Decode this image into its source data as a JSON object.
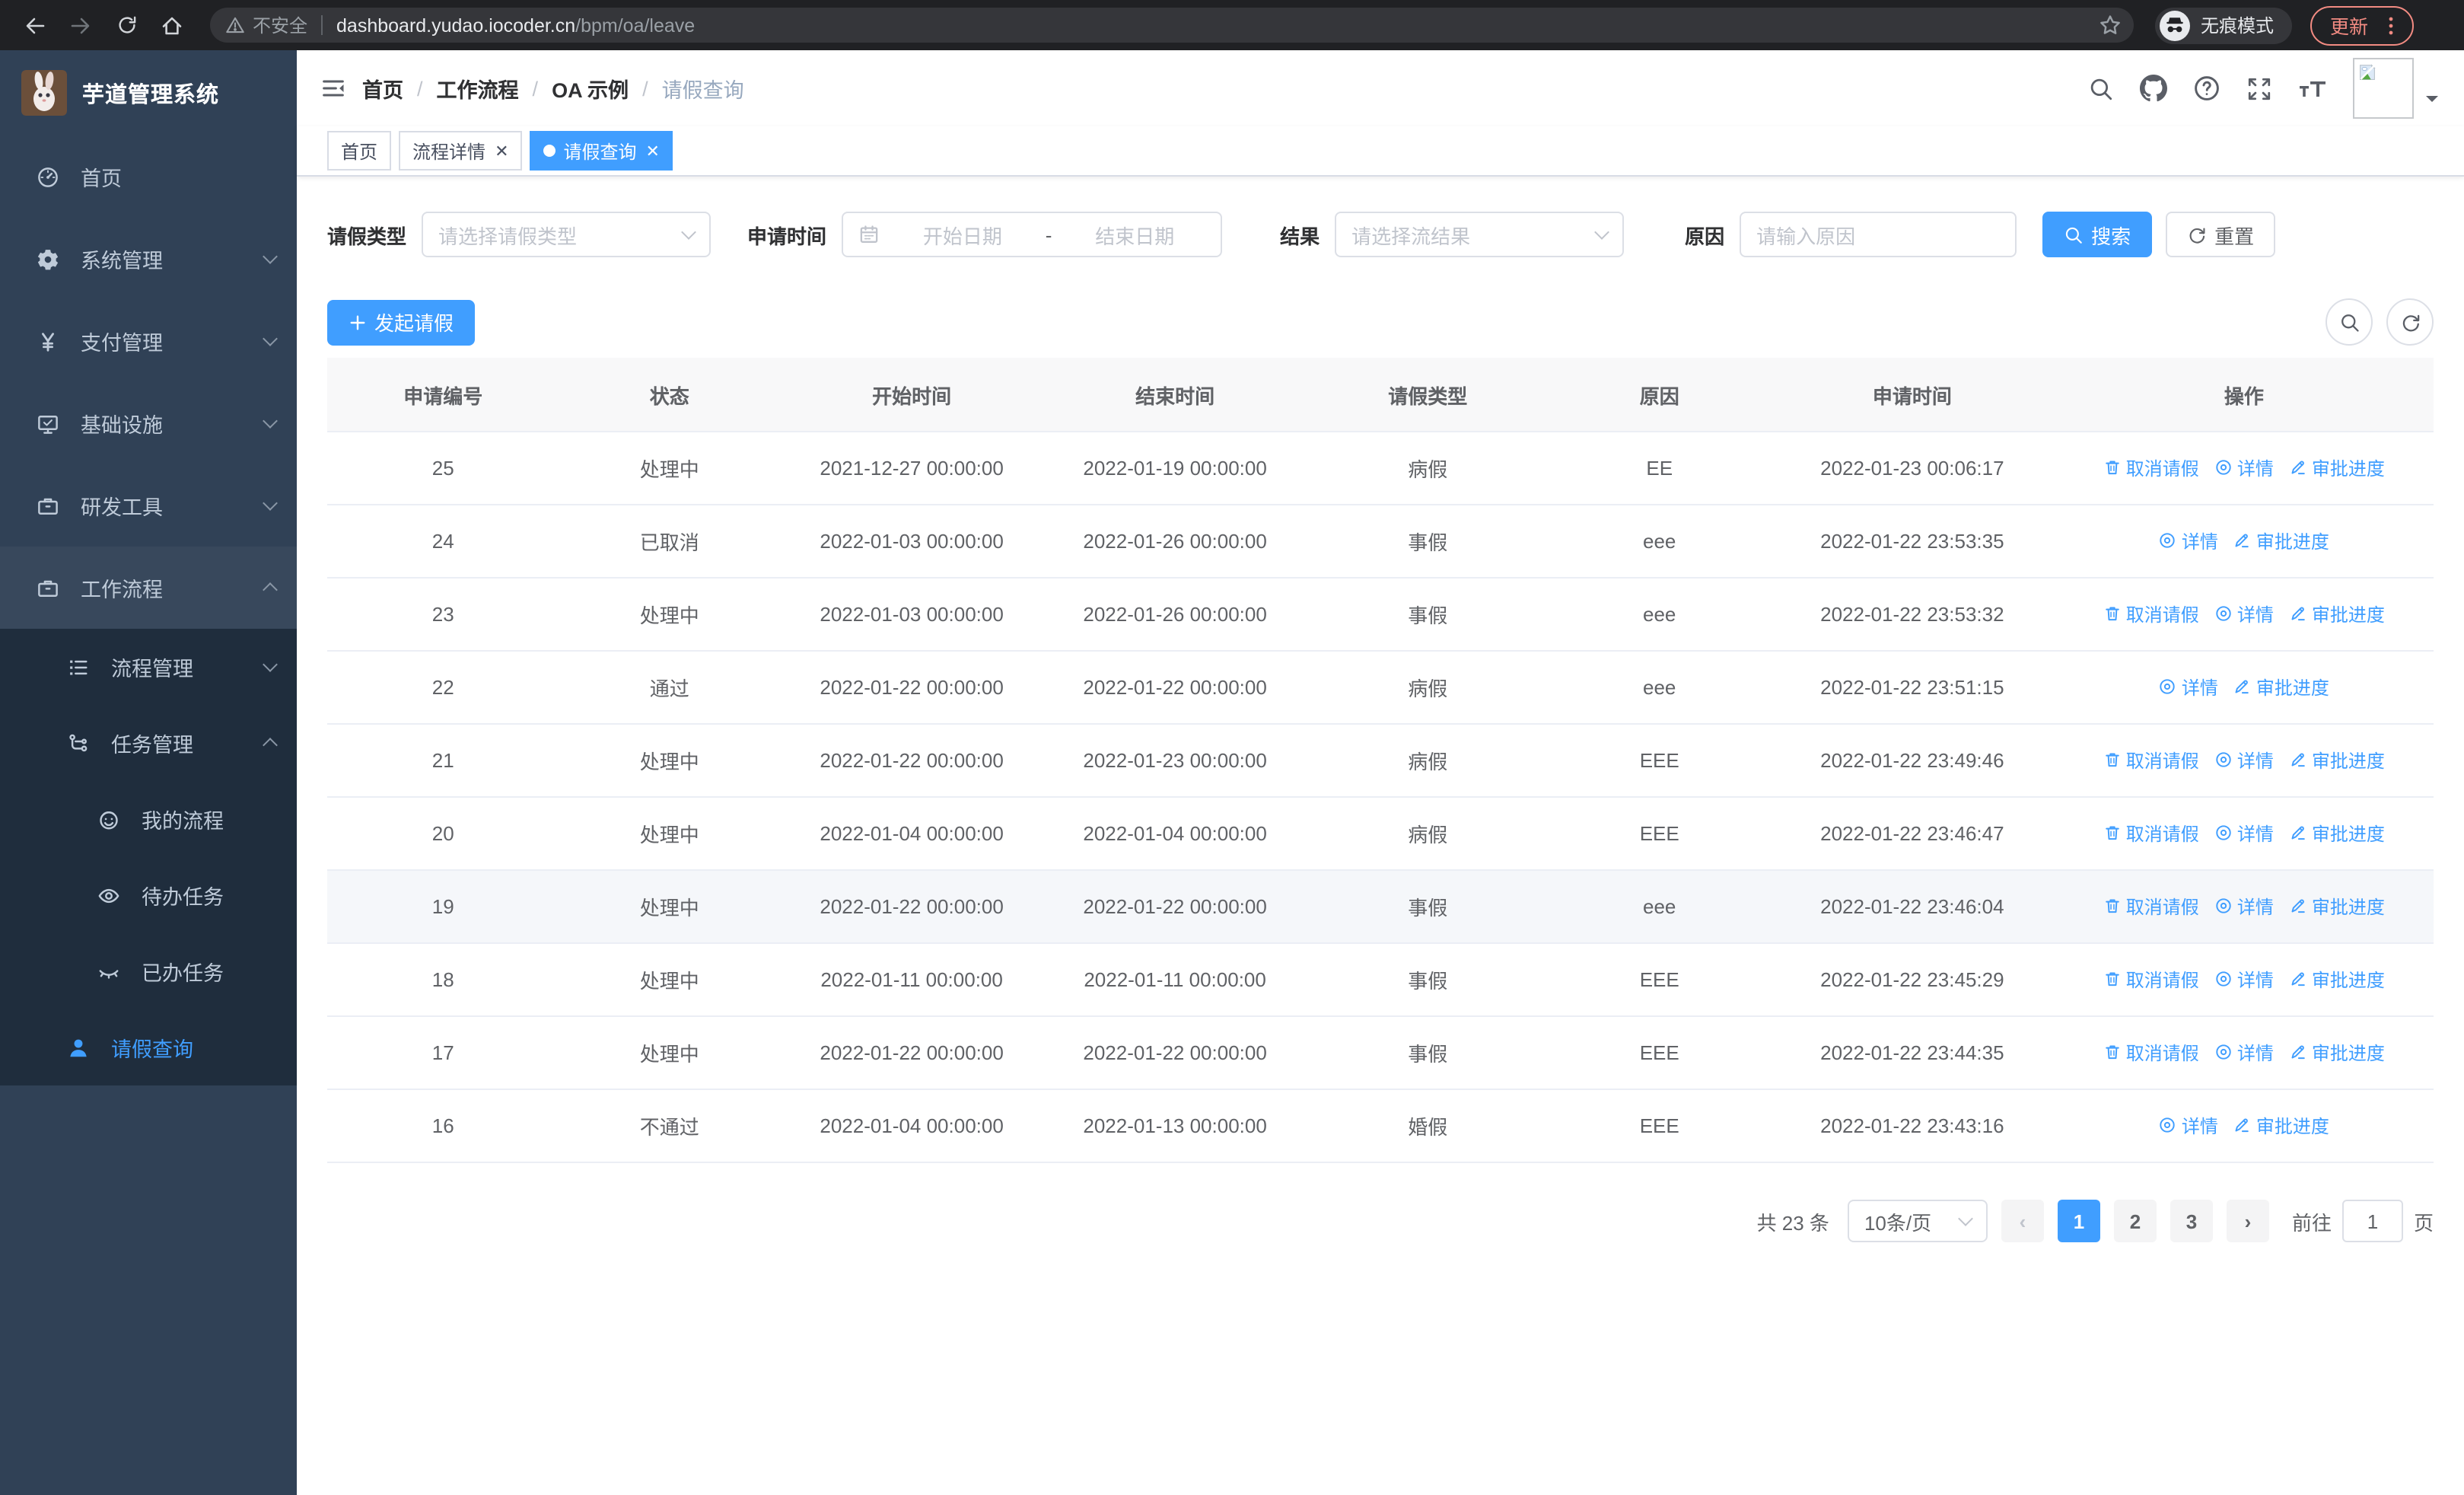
{
  "browser": {
    "security_label": "不安全",
    "url_host": "dashboard.yudao.iocoder.cn",
    "url_path": "/bpm/oa/leave",
    "incognito_label": "无痕模式",
    "update_label": "更新"
  },
  "sidebar": {
    "title": "芋道管理系统",
    "items": [
      {
        "label": "首页",
        "icon": "dashboard-icon",
        "level": 1
      },
      {
        "label": "系统管理",
        "icon": "gear-icon",
        "level": 1,
        "chevron": "down"
      },
      {
        "label": "支付管理",
        "icon": "yen-icon",
        "level": 1,
        "chevron": "down"
      },
      {
        "label": "基础设施",
        "icon": "monitor-icon",
        "level": 1,
        "chevron": "down"
      },
      {
        "label": "研发工具",
        "icon": "briefcase-icon",
        "level": 1,
        "chevron": "down"
      },
      {
        "label": "工作流程",
        "icon": "workflow-icon",
        "level": 1,
        "chevron": "up",
        "open": true
      },
      {
        "label": "流程管理",
        "icon": "process-list-icon",
        "level": 2,
        "chevron": "down",
        "sub": true
      },
      {
        "label": "任务管理",
        "icon": "task-tree-icon",
        "level": 2,
        "chevron": "up",
        "sub": true
      },
      {
        "label": "我的流程",
        "icon": "face-icon",
        "level": 3,
        "sub": true
      },
      {
        "label": "待办任务",
        "icon": "eye-open-icon",
        "level": 3,
        "sub": true
      },
      {
        "label": "已办任务",
        "icon": "eye-closed-icon",
        "level": 3,
        "sub": true
      },
      {
        "label": "请假查询",
        "icon": "user-icon",
        "level": 2,
        "sub": true,
        "active": true
      }
    ]
  },
  "header": {
    "breadcrumb": [
      "首页",
      "工作流程",
      "OA 示例",
      "请假查询"
    ]
  },
  "tabs": [
    {
      "label": "首页",
      "closable": false,
      "active": false
    },
    {
      "label": "流程详情",
      "closable": true,
      "active": false
    },
    {
      "label": "请假查询",
      "closable": true,
      "active": true
    }
  ],
  "filters": {
    "leave_type_label": "请假类型",
    "leave_type_placeholder": "请选择请假类型",
    "apply_time_label": "申请时间",
    "start_date_placeholder": "开始日期",
    "range_separator": "-",
    "end_date_placeholder": "结束日期",
    "result_label": "结果",
    "result_placeholder": "请选择流结果",
    "reason_label": "原因",
    "reason_placeholder": "请输入原因",
    "search_label": "搜索",
    "reset_label": "重置"
  },
  "toolbar": {
    "create_label": "发起请假"
  },
  "table": {
    "columns": [
      "申请编号",
      "状态",
      "开始时间",
      "结束时间",
      "请假类型",
      "原因",
      "申请时间",
      "操作"
    ],
    "action_defs": {
      "cancel": {
        "label": "取消请假",
        "icon": "trash-icon"
      },
      "detail": {
        "label": "详情",
        "icon": "view-icon"
      },
      "progress": {
        "label": "审批进度",
        "icon": "edit-icon"
      }
    },
    "rows": [
      {
        "id": "25",
        "status": "处理中",
        "start": "2021-12-27 00:00:00",
        "end": "2022-01-19 00:00:00",
        "type": "病假",
        "reason": "EE",
        "apply_time": "2022-01-23 00:06:17",
        "actions": [
          "cancel",
          "detail",
          "progress"
        ],
        "highlight": false
      },
      {
        "id": "24",
        "status": "已取消",
        "start": "2022-01-03 00:00:00",
        "end": "2022-01-26 00:00:00",
        "type": "事假",
        "reason": "eee",
        "apply_time": "2022-01-22 23:53:35",
        "actions": [
          "detail",
          "progress"
        ],
        "highlight": false
      },
      {
        "id": "23",
        "status": "处理中",
        "start": "2022-01-03 00:00:00",
        "end": "2022-01-26 00:00:00",
        "type": "事假",
        "reason": "eee",
        "apply_time": "2022-01-22 23:53:32",
        "actions": [
          "cancel",
          "detail",
          "progress"
        ],
        "highlight": false
      },
      {
        "id": "22",
        "status": "通过",
        "start": "2022-01-22 00:00:00",
        "end": "2022-01-22 00:00:00",
        "type": "病假",
        "reason": "eee",
        "apply_time": "2022-01-22 23:51:15",
        "actions": [
          "detail",
          "progress"
        ],
        "highlight": false
      },
      {
        "id": "21",
        "status": "处理中",
        "start": "2022-01-22 00:00:00",
        "end": "2022-01-23 00:00:00",
        "type": "病假",
        "reason": "EEE",
        "apply_time": "2022-01-22 23:49:46",
        "actions": [
          "cancel",
          "detail",
          "progress"
        ],
        "highlight": false
      },
      {
        "id": "20",
        "status": "处理中",
        "start": "2022-01-04 00:00:00",
        "end": "2022-01-04 00:00:00",
        "type": "病假",
        "reason": "EEE",
        "apply_time": "2022-01-22 23:46:47",
        "actions": [
          "cancel",
          "detail",
          "progress"
        ],
        "highlight": false
      },
      {
        "id": "19",
        "status": "处理中",
        "start": "2022-01-22 00:00:00",
        "end": "2022-01-22 00:00:00",
        "type": "事假",
        "reason": "eee",
        "apply_time": "2022-01-22 23:46:04",
        "actions": [
          "cancel",
          "detail",
          "progress"
        ],
        "highlight": true
      },
      {
        "id": "18",
        "status": "处理中",
        "start": "2022-01-11 00:00:00",
        "end": "2022-01-11 00:00:00",
        "type": "事假",
        "reason": "EEE",
        "apply_time": "2022-01-22 23:45:29",
        "actions": [
          "cancel",
          "detail",
          "progress"
        ],
        "highlight": false
      },
      {
        "id": "17",
        "status": "处理中",
        "start": "2022-01-22 00:00:00",
        "end": "2022-01-22 00:00:00",
        "type": "事假",
        "reason": "EEE",
        "apply_time": "2022-01-22 23:44:35",
        "actions": [
          "cancel",
          "detail",
          "progress"
        ],
        "highlight": false
      },
      {
        "id": "16",
        "status": "不通过",
        "start": "2022-01-04 00:00:00",
        "end": "2022-01-13 00:00:00",
        "type": "婚假",
        "reason": "EEE",
        "apply_time": "2022-01-22 23:43:16",
        "actions": [
          "detail",
          "progress"
        ],
        "highlight": false
      }
    ]
  },
  "pagination": {
    "total_label": "共 23 条",
    "page_size_label": "10条/页",
    "pages": [
      "1",
      "2",
      "3"
    ],
    "active_page": "1",
    "goto_label": "前往",
    "goto_value": "1",
    "page_unit_label": "页"
  },
  "colors": {
    "primary": "#409eff",
    "sidebar_bg": "#304156",
    "submenu_bg": "#1f2d3d",
    "chrome_bg": "#202124",
    "update_accent": "#f28b82",
    "table_header_bg": "#f8f8f9",
    "row_highlight_bg": "#f5f7fa"
  }
}
